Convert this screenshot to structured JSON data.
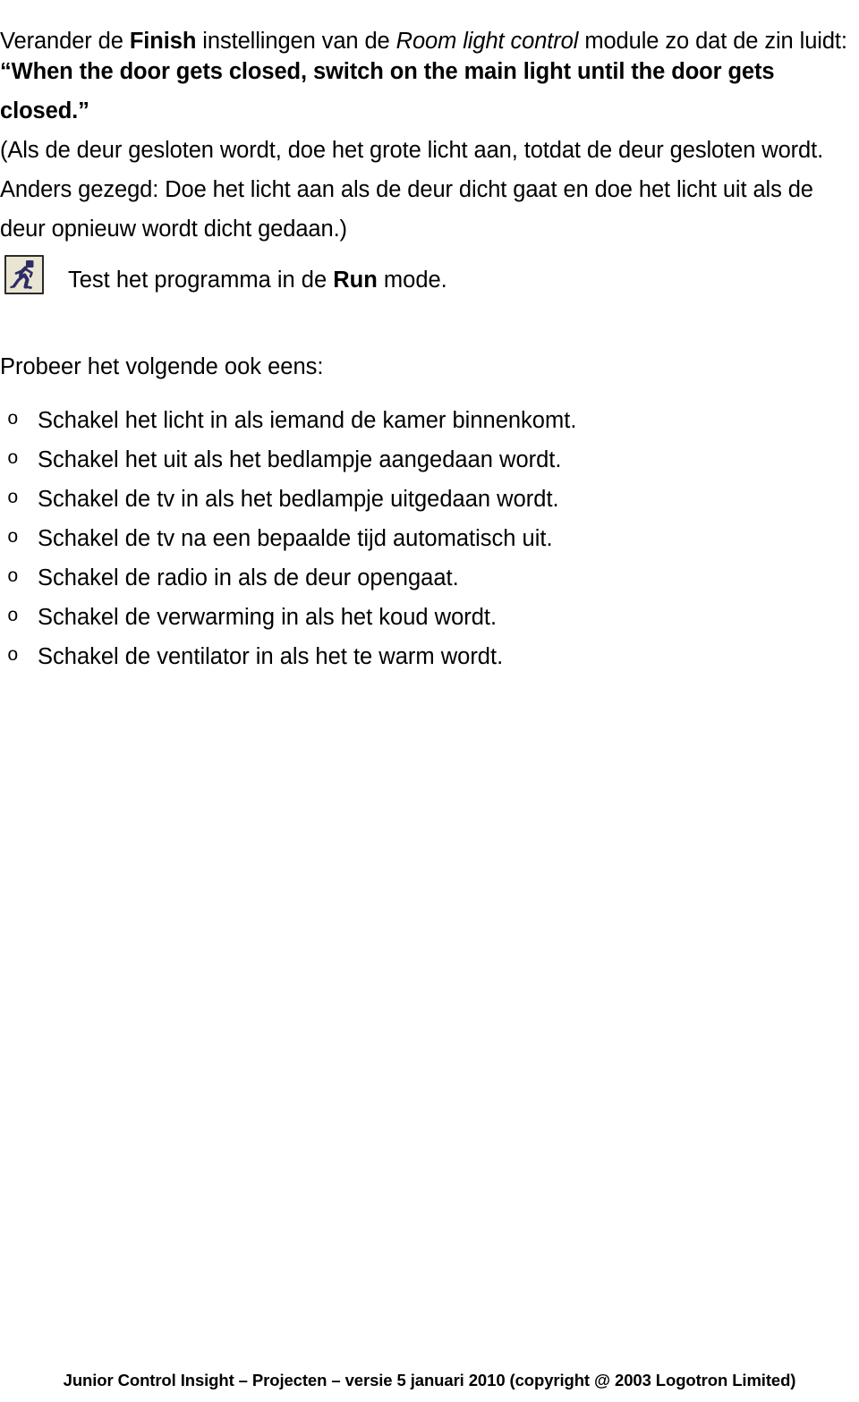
{
  "document": {
    "intro": {
      "text_before_bold": "Verander de ",
      "bold_term": "Finish",
      "text_after_bold": " instellingen van de ",
      "italic_term": "Room light control",
      "text_end": " module zo dat de zin luidt:"
    },
    "quote": "“When the door gets closed, switch on the main light until the door gets closed.”",
    "explanation": "(Als de deur gesloten wordt, doe het grote licht aan, totdat de deur gesloten wordt. Anders gezegd: Doe het licht aan als de deur dicht gaat en doe het licht uit als de deur opnieuw wordt dicht gedaan.)",
    "test_instruction": {
      "text_before_bold": "Test het programma in de ",
      "bold_term": "Run",
      "text_after_bold": " mode."
    },
    "try_heading": "Probeer het volgende ook eens:",
    "bullet_marker": "o",
    "bullets": [
      "Schakel het licht in als iemand de kamer binnenkomt.",
      "Schakel het uit als het bedlampje aangedaan wordt.",
      "Schakel de tv in als het bedlampje uitgedaan wordt.",
      "Schakel de tv na een bepaalde tijd automatisch uit.",
      "Schakel de radio in als de deur opengaat.",
      "Schakel de verwarming in als het koud wordt.",
      "Schakel de ventilator in als het te warm wordt."
    ],
    "footer": "Junior Control Insight – Projecten – versie 5 januari 2010 (copyright @ 2003 Logotron Limited)",
    "icon": {
      "name": "run-mode-icon",
      "figure_color": "#2d2d63",
      "background_color": "#e9e5d3",
      "border_color": "#2b2b2b"
    }
  }
}
